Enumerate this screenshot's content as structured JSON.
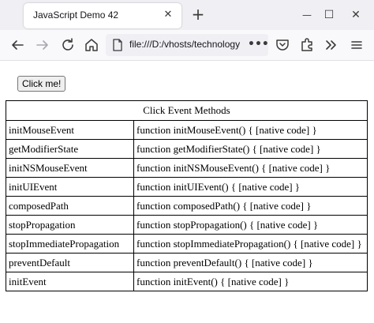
{
  "browser": {
    "tab_title": "JavaScript Demo 42",
    "tab_close": "✕",
    "new_tab": "+",
    "url": "file:///D:/vhosts/technology",
    "url_overflow": "•••",
    "window_controls": {
      "minimize": "—",
      "maximize": "☐",
      "close": "✕"
    }
  },
  "page": {
    "button_label": "Click me!",
    "table": {
      "caption": "Click Event Methods",
      "rows": [
        {
          "name": "initMouseEvent",
          "value": "function initMouseEvent() { [native code] }"
        },
        {
          "name": "getModifierState",
          "value": "function getModifierState() { [native code] }"
        },
        {
          "name": "initNSMouseEvent",
          "value": "function initNSMouseEvent() { [native code] }"
        },
        {
          "name": "initUIEvent",
          "value": "function initUIEvent() { [native code] }"
        },
        {
          "name": "composedPath",
          "value": "function composedPath() { [native code] }"
        },
        {
          "name": "stopPropagation",
          "value": "function stopPropagation() { [native code] }"
        },
        {
          "name": "stopImmediatePropagation",
          "value": "function stopImmediatePropagation() { [native code] }"
        },
        {
          "name": "preventDefault",
          "value": "function preventDefault() { [native code] }"
        },
        {
          "name": "initEvent",
          "value": "function initEvent() { [native code] }"
        }
      ]
    }
  }
}
